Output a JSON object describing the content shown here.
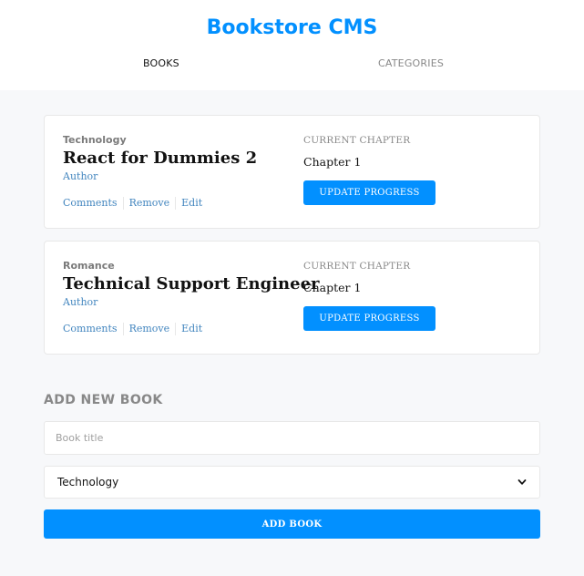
{
  "header": {
    "logo": "Bookstore CMS",
    "nav": [
      {
        "label": "BOOKS"
      },
      {
        "label": "CATEGORIES"
      }
    ]
  },
  "books": [
    {
      "genre": "Technology",
      "title": "React for Dummies 2",
      "author": "Author",
      "actions": {
        "comments": "Comments",
        "remove": "Remove",
        "edit": "Edit"
      },
      "chapter_label": "CURRENT CHAPTER",
      "chapter": "Chapter 1",
      "update_label": "UPDATE PROGRESS"
    },
    {
      "genre": "Romance",
      "title": "Technical Support Engineer",
      "author": "Author",
      "actions": {
        "comments": "Comments",
        "remove": "Remove",
        "edit": "Edit"
      },
      "chapter_label": "CURRENT CHAPTER",
      "chapter": "Chapter 1",
      "update_label": "UPDATE PROGRESS"
    }
  ],
  "add_form": {
    "heading": "ADD NEW BOOK",
    "title_placeholder": "Book title",
    "title_value": "",
    "category_selected": "Technology",
    "submit_label": "ADD BOOK"
  },
  "colors": {
    "accent": "#0290ff",
    "link": "#4386bf",
    "background": "#f7f8fa"
  },
  "icons": {
    "select_arrow": "chevron-down-icon"
  }
}
